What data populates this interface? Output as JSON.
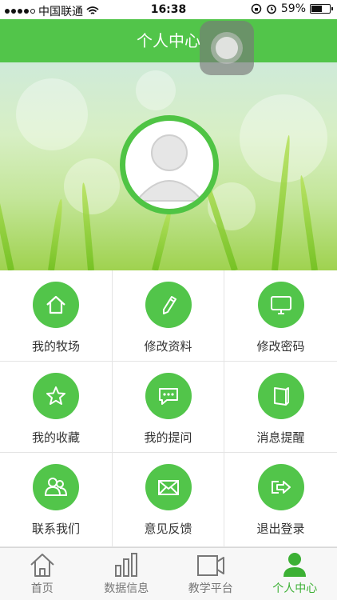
{
  "status_bar": {
    "carrier": "中国联通",
    "time": "16:38",
    "battery": "59%",
    "battery_level": 0.59
  },
  "header": {
    "title": "个人中心"
  },
  "menu": [
    {
      "label": "我的牧场",
      "icon": "home-icon"
    },
    {
      "label": "修改资料",
      "icon": "pencil-icon"
    },
    {
      "label": "修改密码",
      "icon": "monitor-icon"
    },
    {
      "label": "我的收藏",
      "icon": "star-icon"
    },
    {
      "label": "我的提问",
      "icon": "chat-bubble-icon"
    },
    {
      "label": "消息提醒",
      "icon": "book-icon"
    },
    {
      "label": "联系我们",
      "icon": "people-icon"
    },
    {
      "label": "意见反馈",
      "icon": "envelope-icon"
    },
    {
      "label": "退出登录",
      "icon": "logout-icon"
    }
  ],
  "tabbar": [
    {
      "label": "首页",
      "icon": "home-outline-icon",
      "active": false
    },
    {
      "label": "数据信息",
      "icon": "bar-chart-icon",
      "active": false
    },
    {
      "label": "教学平台",
      "icon": "video-camera-icon",
      "active": false
    },
    {
      "label": "个人中心",
      "icon": "person-icon",
      "active": true
    }
  ],
  "colors": {
    "accent": "#52c54a",
    "tab_active": "#3cb034",
    "tab_inactive": "#777777"
  }
}
